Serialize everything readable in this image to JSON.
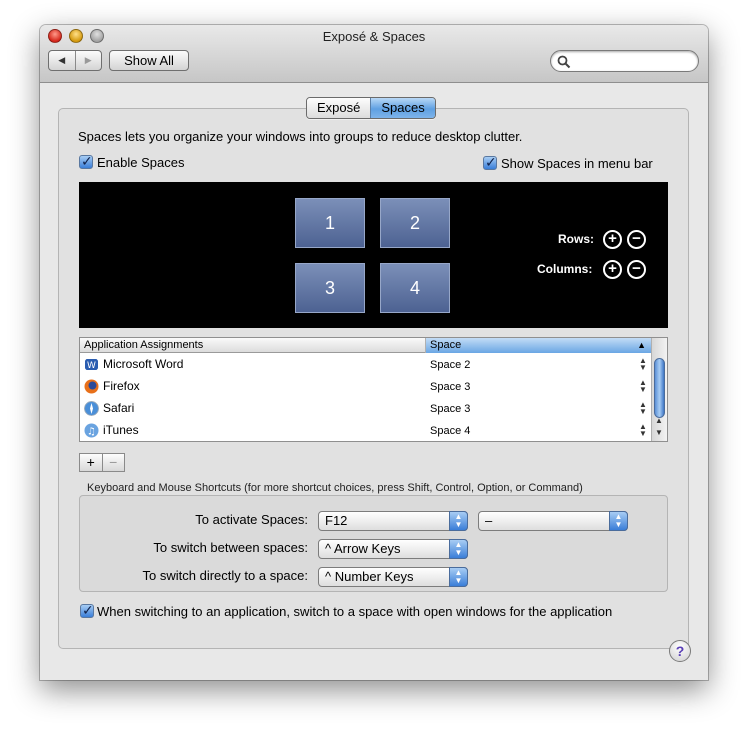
{
  "window": {
    "title": "Exposé & Spaces"
  },
  "toolbar": {
    "back": "◀",
    "forward": "▶",
    "show_all": "Show All",
    "search_placeholder": ""
  },
  "tabs": [
    {
      "label": "Exposé",
      "selected": false
    },
    {
      "label": "Spaces",
      "selected": true
    }
  ],
  "description": "Spaces lets you organize your windows into groups to reduce desktop clutter.",
  "enable_spaces": {
    "label": "Enable Spaces",
    "checked": true
  },
  "show_in_menu_bar": {
    "label": "Show Spaces in menu bar",
    "checked": true
  },
  "preview": {
    "spaces": [
      "1",
      "2",
      "3",
      "4"
    ],
    "rows_label": "Rows:",
    "columns_label": "Columns:",
    "plus": "+",
    "minus": "−"
  },
  "assignments": {
    "col_app": "Application Assignments",
    "col_space": "Space",
    "sort_indicator": "▲",
    "rows": [
      {
        "app": "Microsoft Word",
        "space": "Space 2",
        "icon": "word-icon",
        "color": "#2a5db0"
      },
      {
        "app": "Firefox",
        "space": "Space 3",
        "icon": "firefox-icon",
        "color": "#e8701a"
      },
      {
        "app": "Safari",
        "space": "Space 3",
        "icon": "safari-icon",
        "color": "#4a8fd8"
      },
      {
        "app": "iTunes",
        "space": "Space 4",
        "icon": "itunes-icon",
        "color": "#6aa3e0"
      }
    ],
    "add": "+",
    "remove": "−"
  },
  "shortcuts": {
    "title": "Keyboard and Mouse Shortcuts (for more shortcut choices, press Shift, Control, Option, or Command)",
    "activate_label": "To activate Spaces:",
    "activate_value": "F12",
    "activate_mouse_value": "–",
    "switch_between_label": "To switch between spaces:",
    "switch_between_value": "^ Arrow Keys",
    "switch_directly_label": "To switch directly to a space:",
    "switch_directly_value": "^ Number Keys"
  },
  "switch_to_app_space": {
    "label": "When switching to an application, switch to a space with open windows for the application",
    "checked": true
  },
  "help": "?"
}
